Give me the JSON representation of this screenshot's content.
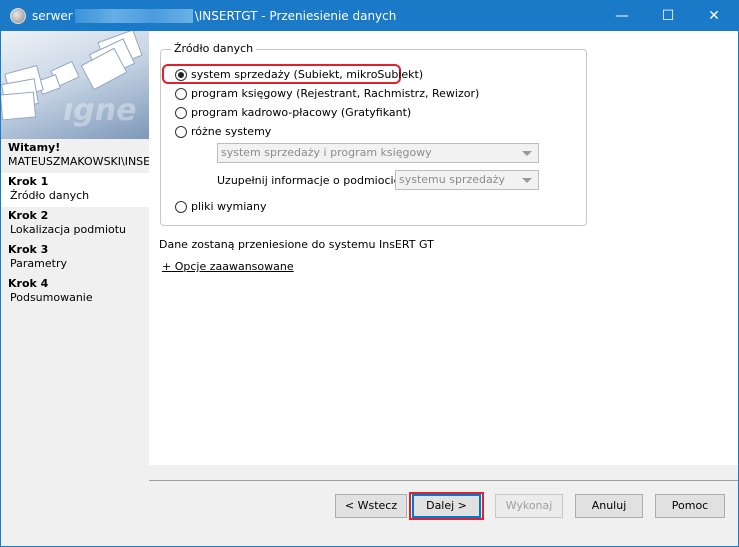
{
  "window": {
    "title_prefix": "serwer",
    "title_suffix": "\\INSERTGT - Przeniesienie danych",
    "minimize": "—",
    "maximize": "☐",
    "close": "✕"
  },
  "sidebar": {
    "welcome_title": "Witamy!",
    "welcome_user": "MATEUSZMAKOWSKI\\INSE",
    "steps": [
      {
        "title": "Krok 1",
        "label": "Źródło danych"
      },
      {
        "title": "Krok 2",
        "label": "Lokalizacja podmiotu"
      },
      {
        "title": "Krok 3",
        "label": "Parametry"
      },
      {
        "title": "Krok 4",
        "label": "Podsumowanie"
      }
    ]
  },
  "source": {
    "group_title": "Źródło danych",
    "options": [
      {
        "label": "system sprzedaży (Subiekt, mikroSubiekt)",
        "checked": true
      },
      {
        "label": "program księgowy (Rejestrant, Rachmistrz, Rewizor)",
        "checked": false
      },
      {
        "label": "program kadrowo-płacowy  (Gratyfikant)",
        "checked": false
      },
      {
        "label": "różne systemy",
        "checked": false
      },
      {
        "label": "pliki wymiany",
        "checked": false
      }
    ],
    "systems_combo": "system sprzedaży i program księgowy",
    "complete_label": "Uzupełnij informacje o podmiocie z:",
    "complete_combo": "systemu sprzedaży"
  },
  "info_text": "Dane zostaną przeniesione do systemu InsERT GT",
  "advanced_link": "+ Opcje zaawansowane",
  "buttons": {
    "back": "< Wstecz",
    "next": "Dalej >",
    "execute": "Wykonaj",
    "cancel": "Anuluj",
    "help": "Pomoc"
  }
}
